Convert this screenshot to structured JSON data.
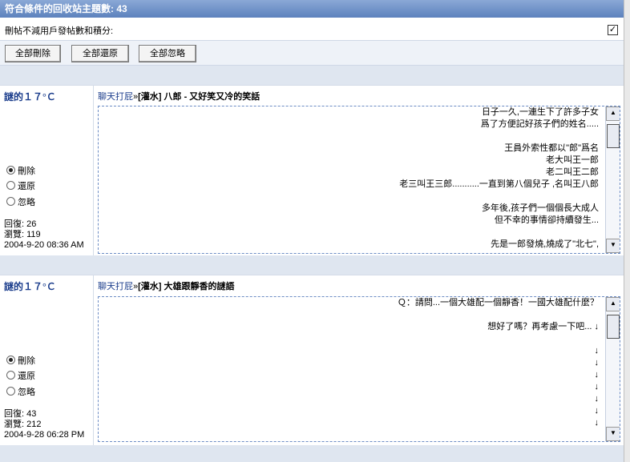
{
  "header": {
    "title": "符合條件的回收站主題數: 43"
  },
  "options": {
    "label": "刪帖不減用戶發帖數和積分:",
    "checked": "✓"
  },
  "buttons": {
    "delete_all": "全部刪除",
    "restore_all": "全部還原",
    "ignore_all": "全部忽略"
  },
  "topics": [
    {
      "user": "謎的１７°Ｃ",
      "forum": "聊天打屁",
      "sep": "»",
      "subject": "[灌水] 八郎 - 又好笑又冷的笑話",
      "content": "日子一久,一連生下了許多子女\n爲了方便記好孩子們的姓名.....\n\n王員外索性都以\"郎\"爲名\n老大叫王一郎\n老二叫王二郎\n老三叫王三郎...........一直到第八個兒子 ,名叫王八郎\n\n多年後,孩子們一個個長大成人\n但不幸的事情卻持續發生...\n\n先是一郎發燒,燒成了\"北七\",",
      "options": [
        "刪除",
        "還原",
        "忽略"
      ],
      "replies": "回復: 26",
      "views": "瀏覽: 119",
      "date": "2004-9-20 08:36 AM"
    },
    {
      "user": "謎的１７°Ｃ",
      "forum": "聊天打屁",
      "sep": "»",
      "subject": "[灌水] 大雄跟靜香的謎語",
      "content": "Ｑ：請問...一個大雄配一個靜香！一國大雄配什麼？\n\n想好了嗎？再考慮一下吧... ↓\n\n↓\n↓\n↓\n↓\n↓\n↓\n↓",
      "options": [
        "刪除",
        "還原",
        "忽略"
      ],
      "replies": "回復: 43",
      "views": "瀏覽: 212",
      "date": "2004-9-28 06:28 PM"
    }
  ]
}
